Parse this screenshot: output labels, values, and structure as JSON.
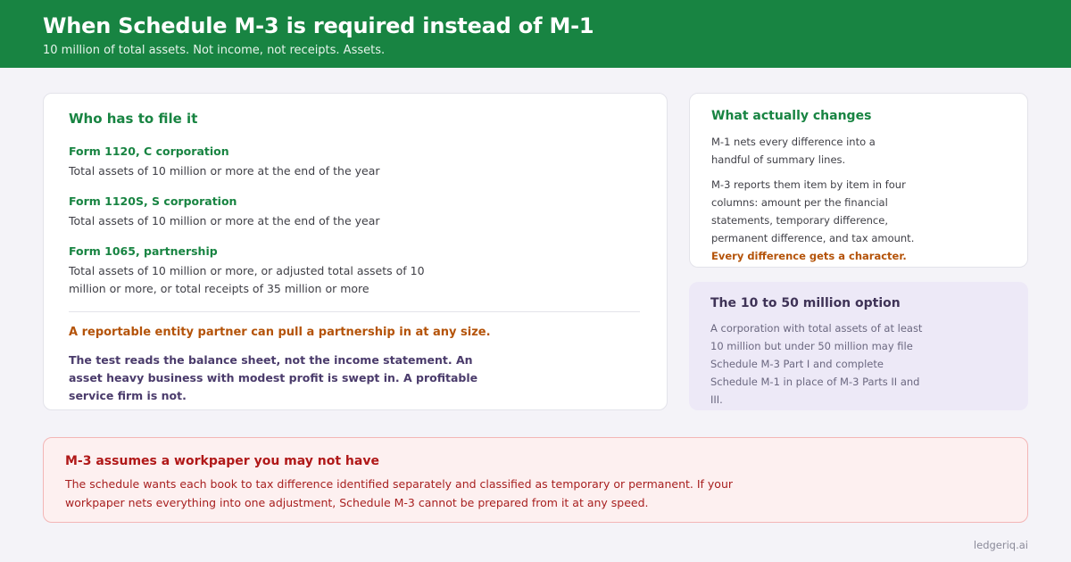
{
  "header": {
    "title": "When Schedule M-3 is required instead of M-1",
    "subtitle": "10 million of total assets. Not income, not receipts. Assets."
  },
  "who_files": {
    "heading": "Who has to file it",
    "forms": [
      {
        "name": "Form 1120, C corporation",
        "text": "Total assets of 10 million or more at the end of the year"
      },
      {
        "name": "Form 1120S, S corporation",
        "text": "Total assets of 10 million or more at the end of the year"
      },
      {
        "name": "Form 1065, partnership",
        "text": "Total assets of 10 million or more, or adjusted total assets of 10 million or more, or total receipts of 35 million or more"
      }
    ],
    "alert": "A reportable entity partner can pull a partnership in at any size.",
    "note": "The test reads the balance sheet, not the income statement. An asset heavy business with modest profit is swept in. A profitable service firm is not."
  },
  "changes": {
    "heading": "What actually changes",
    "para1": "M-1 nets every difference into a handful of summary lines.",
    "para2": "M-3 reports them item by item in four columns: amount per the financial statements, temporary difference, permanent difference, and tax amount.",
    "emphasis": "Every difference gets a character."
  },
  "option": {
    "heading": "The 10 to 50 million option",
    "text": "A corporation with total assets of at least 10 million but under 50 million may file Schedule M-3 Part I and complete Schedule M-1 in place of M-3 Parts II and III."
  },
  "warning": {
    "heading": "M-3 assumes a workpaper you may not have",
    "text": "The schedule wants each book to tax difference identified separately and classified as temporary or permanent. If your workpaper nets everything into one adjustment, Schedule M-3 cannot be prepared from it at any speed."
  },
  "footer": {
    "brand": "ledgeriq.ai"
  }
}
